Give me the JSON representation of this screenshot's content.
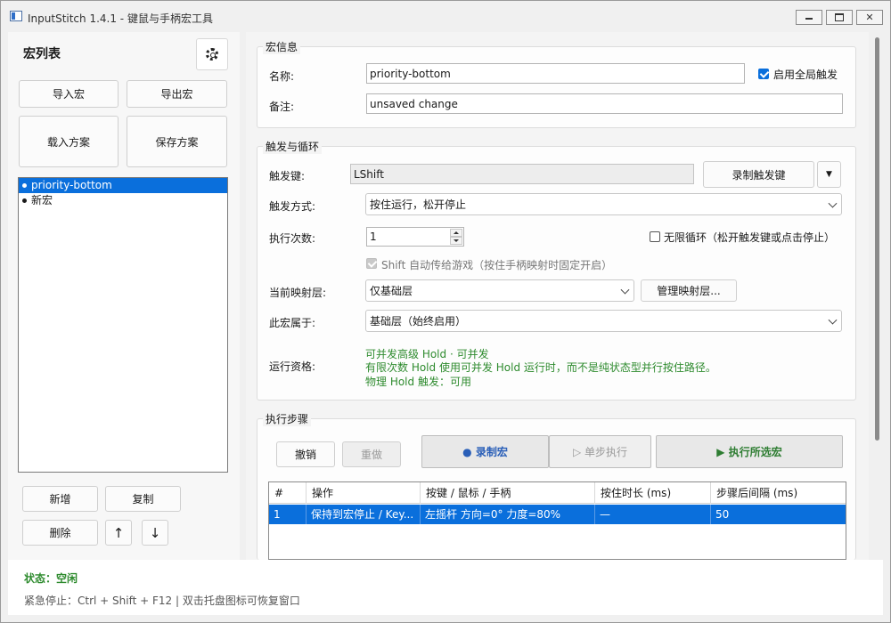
{
  "window": {
    "title": "InputStitch 1.4.1 - 键鼠与手柄宏工具"
  },
  "left": {
    "title": "宏列表",
    "import_label": "导入宏",
    "export_label": "导出宏",
    "load_scheme_label": "载入方案",
    "save_scheme_label": "保存方案",
    "macros": [
      {
        "name": "priority-bottom",
        "selected": true
      },
      {
        "name": "新宏",
        "selected": false
      }
    ],
    "add_label": "新增",
    "copy_label": "复制",
    "delete_label": "删除",
    "up_label": "↑",
    "down_label": "↓"
  },
  "info": {
    "group_title": "宏信息",
    "name_label": "名称:",
    "name_value": "priority-bottom",
    "global_trigger_label": "启用全局触发",
    "global_trigger_checked": true,
    "note_label": "备注:",
    "note_value": "unsaved change"
  },
  "trigger": {
    "group_title": "触发与循环",
    "key_label": "触发键:",
    "key_value": "LShift",
    "record_key_label": "录制触发键",
    "mode_label": "触发方式:",
    "mode_value": "按住运行，松开停止",
    "count_label": "执行次数:",
    "count_value": "1",
    "infinite_label": "无限循环（松开触发键或点击停止）",
    "infinite_checked": false,
    "passthrough_label": "Shift 自动传给游戏（按住手柄映射时固定开启）",
    "layer_label": "当前映射层:",
    "layer_value": "仅基础层",
    "manage_layer_label": "管理映射层...",
    "belongs_label": "此宏属于:",
    "belongs_value": "基础层（始终启用）",
    "eligibility_label": "运行资格:",
    "eligibility_lines": [
      "可并发高级 Hold · 可并发",
      "有限次数 Hold 使用可并发 Hold 运行时，而不是纯状态型并行按住路径。",
      "物理 Hold 触发：可用"
    ]
  },
  "steps": {
    "group_title": "执行步骤",
    "undo_label": "撤销",
    "redo_label": "重做",
    "record_label": "● 录制宏",
    "step_label": "▷ 单步执行",
    "run_label": "▶ 执行所选宏",
    "columns": [
      "#",
      "操作",
      "按键 / 鼠标 / 手柄",
      "按住时长 (ms)",
      "步骤后间隔 (ms)"
    ],
    "rows": [
      [
        "1",
        "保持到宏停止 / Key...",
        "左摇杆 方向=0° 力度=80%",
        "—",
        "50"
      ]
    ]
  },
  "status": {
    "state": "状态：空闲",
    "hint": "紧急停止：Ctrl + Shift + F12    |    双击托盘图标可恢复窗口"
  },
  "colors": {
    "accent": "#0a6fdc",
    "status_green": "#2e8b2e"
  }
}
